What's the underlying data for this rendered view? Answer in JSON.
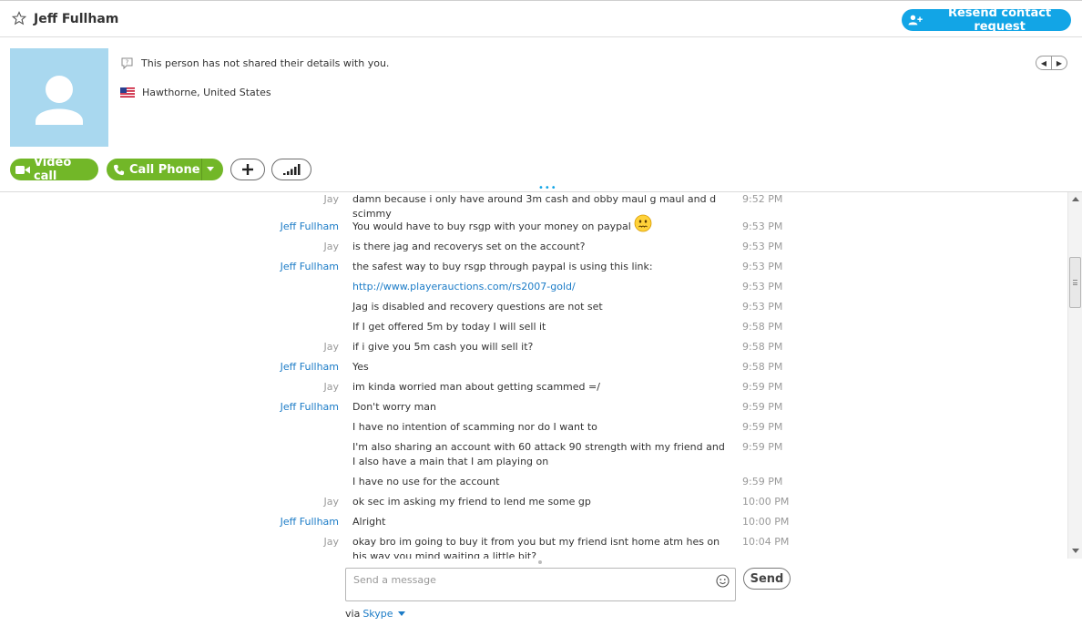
{
  "header": {
    "contact_name": "Jeff Fullham",
    "resend_label": "Resend contact request"
  },
  "profile": {
    "details_note": "This person has not shared their details with you.",
    "location": "Hawthorne, United States"
  },
  "actions": {
    "video_call": "Video call",
    "call_phone": "Call Phone"
  },
  "messages": [
    {
      "sender": "Jay",
      "text": "damn because i only have around 3m cash and obby maul g maul and d scimmy",
      "time": "9:52 PM"
    },
    {
      "sender": "Jeff Fullham",
      "text": "You would have to buy rsgp with your money on paypal",
      "time": "9:53 PM",
      "emoji": "worried-face"
    },
    {
      "sender": "Jay",
      "text": "is there jag and recoverys set on the account?",
      "time": "9:53 PM"
    },
    {
      "sender": "Jeff Fullham",
      "text": "the safest way to buy rsgp through paypal is using this link:",
      "time": "9:53 PM"
    },
    {
      "sender": "",
      "text": "http://www.playerauctions.com/rs2007-gold/",
      "time": "9:53 PM",
      "link": true
    },
    {
      "sender": "",
      "text": "Jag is disabled and recovery questions are not set",
      "time": "9:53 PM"
    },
    {
      "sender": "",
      "text": "If I get offered 5m by today I will sell it",
      "time": "9:58 PM"
    },
    {
      "sender": "Jay",
      "text": "if i give you 5m cash you will sell it?",
      "time": "9:58 PM"
    },
    {
      "sender": "Jeff Fullham",
      "text": "Yes",
      "time": "9:58 PM"
    },
    {
      "sender": "Jay",
      "text": "im kinda worried man about getting scammed =/",
      "time": "9:59 PM"
    },
    {
      "sender": "Jeff Fullham",
      "text": "Don't worry man",
      "time": "9:59 PM"
    },
    {
      "sender": "",
      "text": "I have no intention of scamming nor do I want to",
      "time": "9:59 PM"
    },
    {
      "sender": "",
      "text": "I'm also sharing an account with 60 attack 90 strength with my friend and I also have a main that I am playing on",
      "time": "9:59 PM"
    },
    {
      "sender": "",
      "text": "I have no use for the account",
      "time": "9:59 PM"
    },
    {
      "sender": "Jay",
      "text": "ok sec im asking my friend to lend me some gp",
      "time": "10:00 PM"
    },
    {
      "sender": "Jeff Fullham",
      "text": "Alright",
      "time": "10:00 PM"
    },
    {
      "sender": "Jay",
      "text": "okay bro im going to buy it from you but my friend isnt home atm hes on his way you mind waiting a little bit?",
      "time": "10:04 PM"
    }
  ],
  "composer": {
    "placeholder": "Send a message",
    "send_label": "Send",
    "via_label": "via",
    "via_service": "Skype"
  },
  "colors": {
    "accent_blue": "#12a5e6",
    "call_green": "#72b728",
    "link_blue": "#1c7cc7",
    "avatar_bg": "#a9d8ef"
  }
}
